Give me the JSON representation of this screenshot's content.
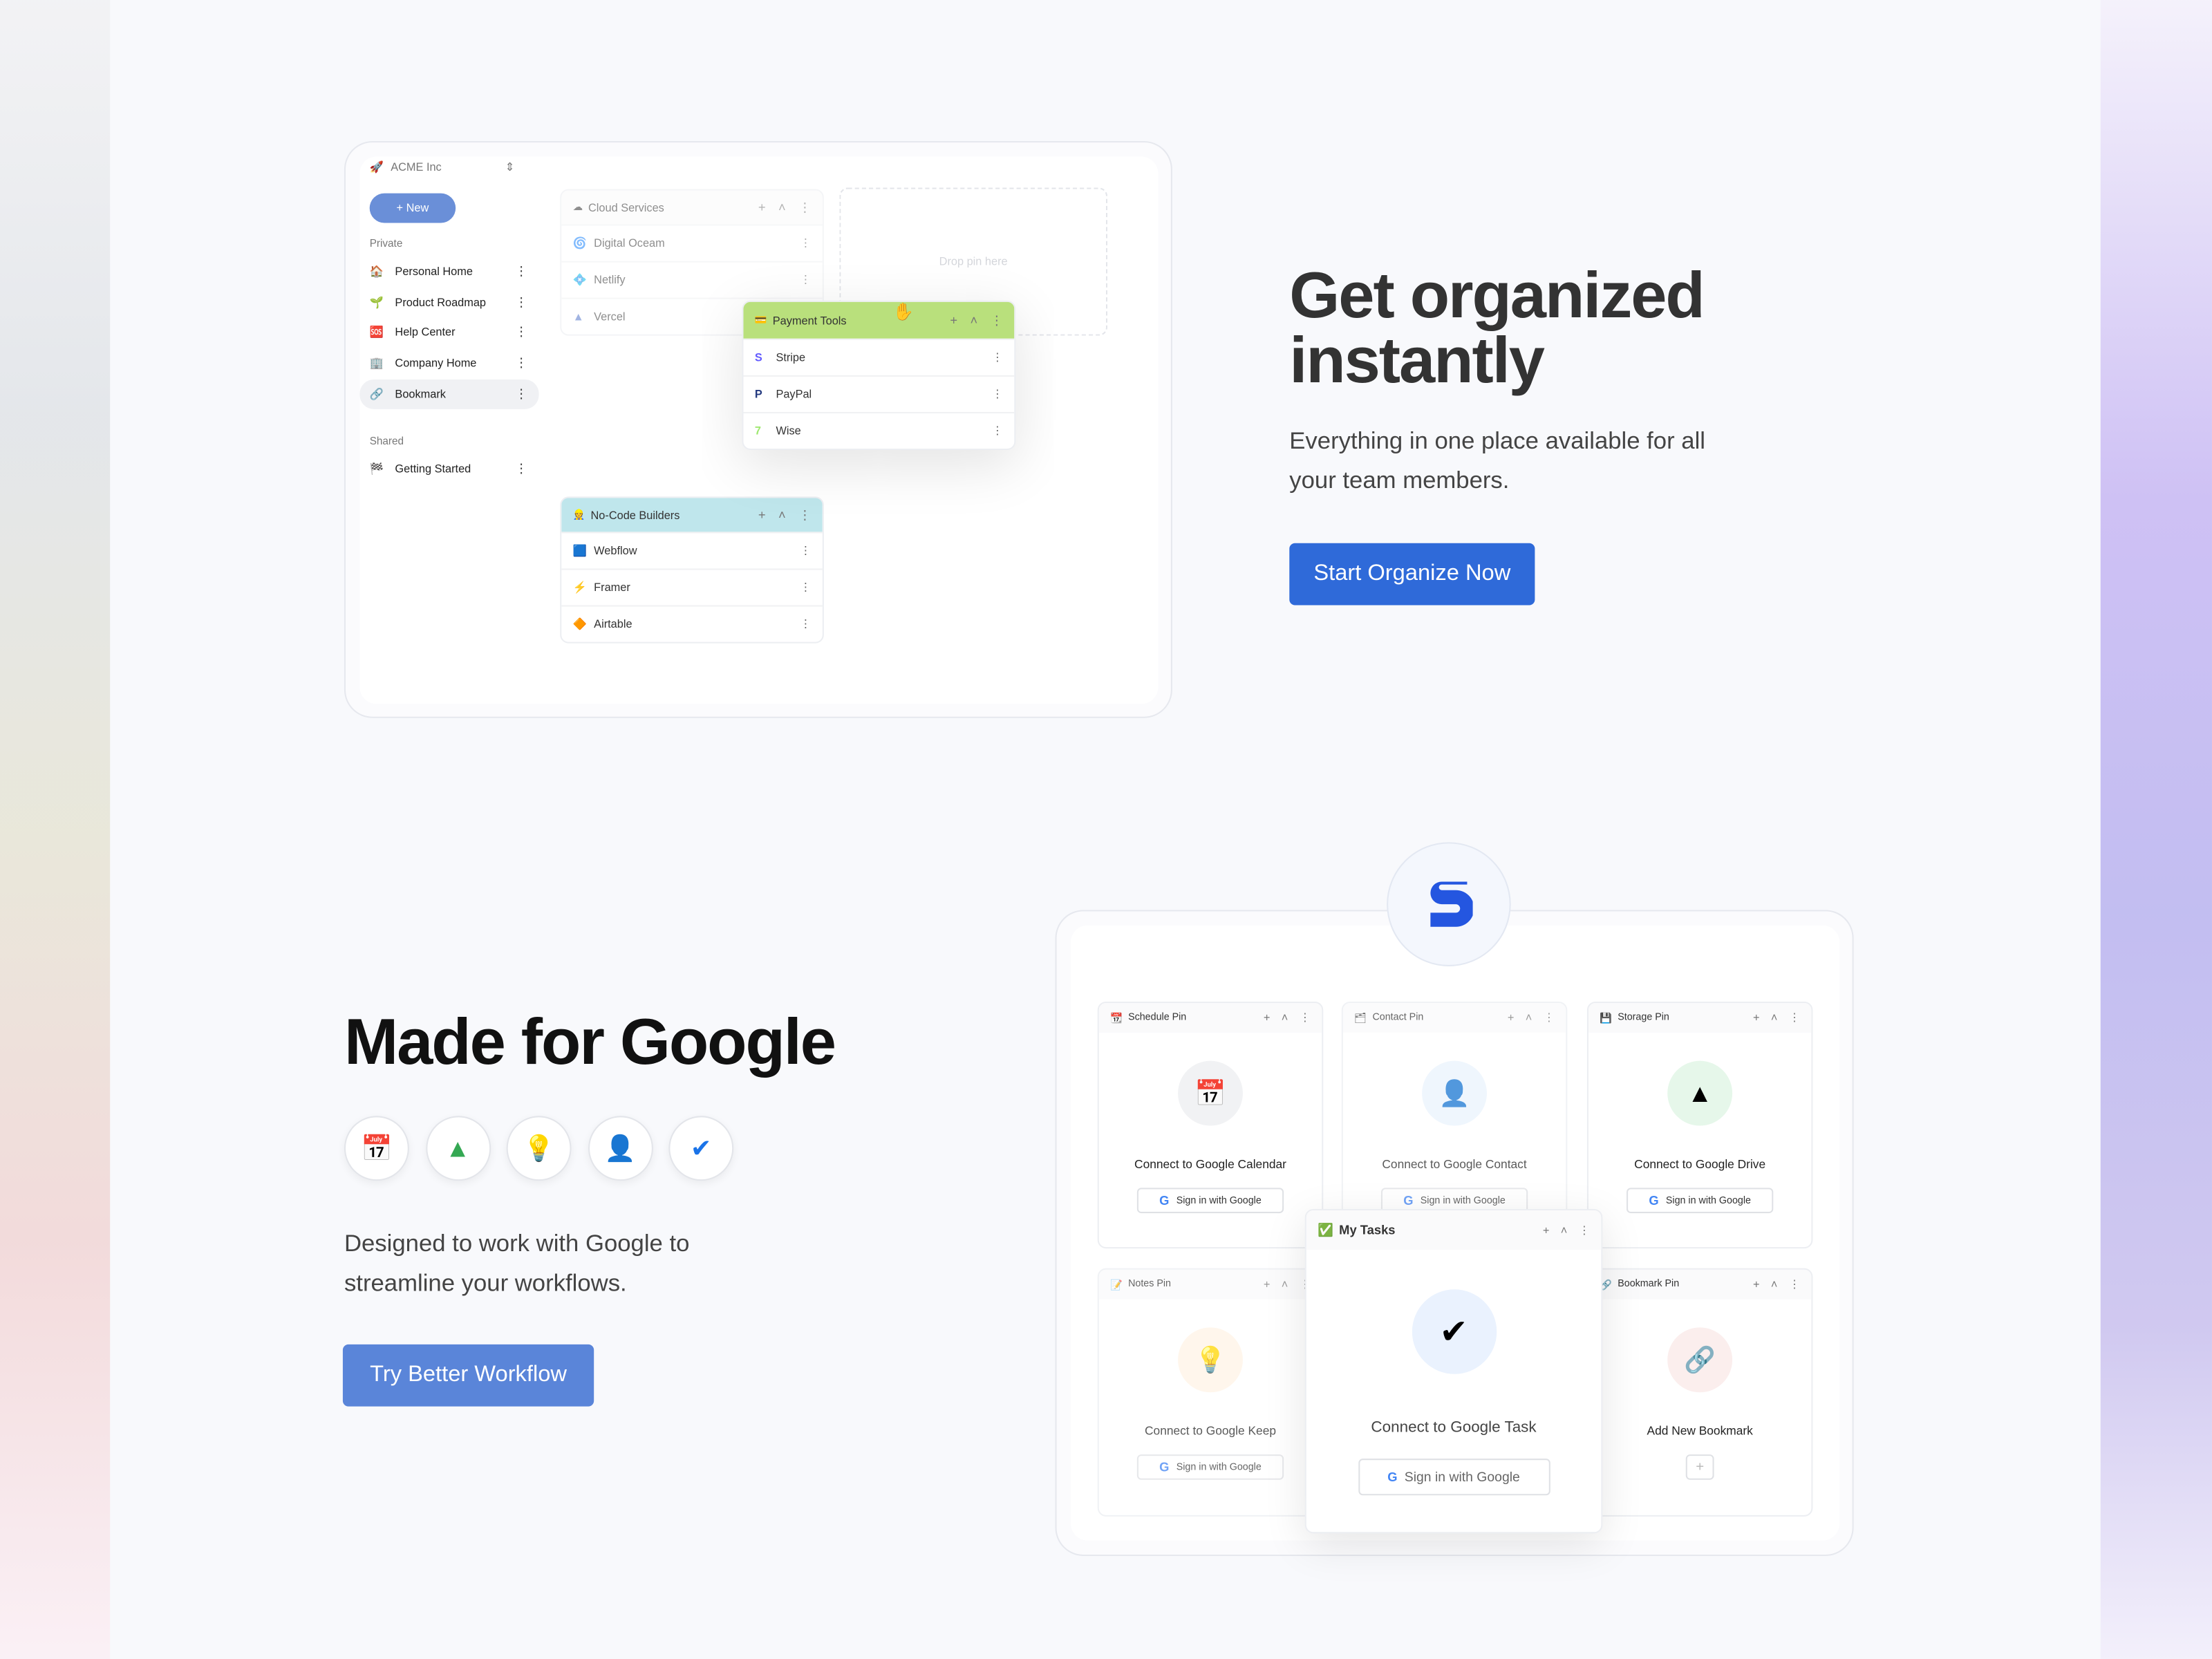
{
  "colors": {
    "primary_button": "#2f6ad9",
    "secondary_button": "#5a85d9",
    "payment_header": "#b9e07c",
    "nocode_header": "#bfe6ec"
  },
  "org": {
    "name": "ACME Inc",
    "icon": "rocket-icon"
  },
  "sidebar": {
    "new_label": "New",
    "private_label": "Private",
    "shared_label": "Shared",
    "private_items": [
      {
        "label": "Personal Home",
        "icon": "house-icon"
      },
      {
        "label": "Product Roadmap",
        "icon": "seedling-icon"
      },
      {
        "label": "Help Center",
        "icon": "sos-icon"
      },
      {
        "label": "Company Home",
        "icon": "building-icon"
      },
      {
        "label": "Bookmark",
        "icon": "link-icon",
        "active": true
      }
    ],
    "shared_items": [
      {
        "label": "Getting Started",
        "icon": "checkered-flag-icon"
      }
    ]
  },
  "panels": {
    "cloud": {
      "title": "Cloud Services",
      "items": [
        "Digital Oceam",
        "Netlify",
        "Vercel"
      ]
    },
    "drop": {
      "text": "Drop pin here"
    },
    "payment": {
      "title": "Payment Tools",
      "items": [
        "Stripe",
        "PayPal",
        "Wise"
      ]
    },
    "nocode": {
      "title": "No-Code Builders",
      "items": [
        "Webflow",
        "Framer",
        "Airtable"
      ]
    }
  },
  "hero1": {
    "title_line1": "Get organized",
    "title_line2": "instantly",
    "desc_line1": "Everything in one place available for all",
    "desc_line2": "your team members.",
    "cta": "Start Organize Now"
  },
  "hero2": {
    "title": "Made for Google",
    "desc_line1": "Designed to work with Google to",
    "desc_line2": "streamline your workflows.",
    "cta": "Try Better Workflow",
    "icons": [
      "google-calendar-icon",
      "google-drive-icon",
      "google-keep-icon",
      "google-contacts-icon",
      "google-tasks-icon"
    ]
  },
  "google_cards": [
    {
      "title": "Schedule Pin",
      "connect": "Connect to Google Calendar",
      "button": "Sign in with Google"
    },
    {
      "title": "Contact Pin",
      "connect": "Connect to Google Contact",
      "button": "Sign in with Google"
    },
    {
      "title": "Storage Pin",
      "connect": "Connect to Google Drive",
      "button": "Sign in with Google"
    },
    {
      "title": "Notes Pin",
      "connect": "Connect to Google Keep",
      "button": "Sign in with Google"
    },
    {
      "title": "Bookmark Pin",
      "connect": "Add New Bookmark",
      "button": "+"
    },
    {
      "title": "My Tasks",
      "connect": "Connect to Google Task",
      "button": "Sign in with Google"
    }
  ]
}
